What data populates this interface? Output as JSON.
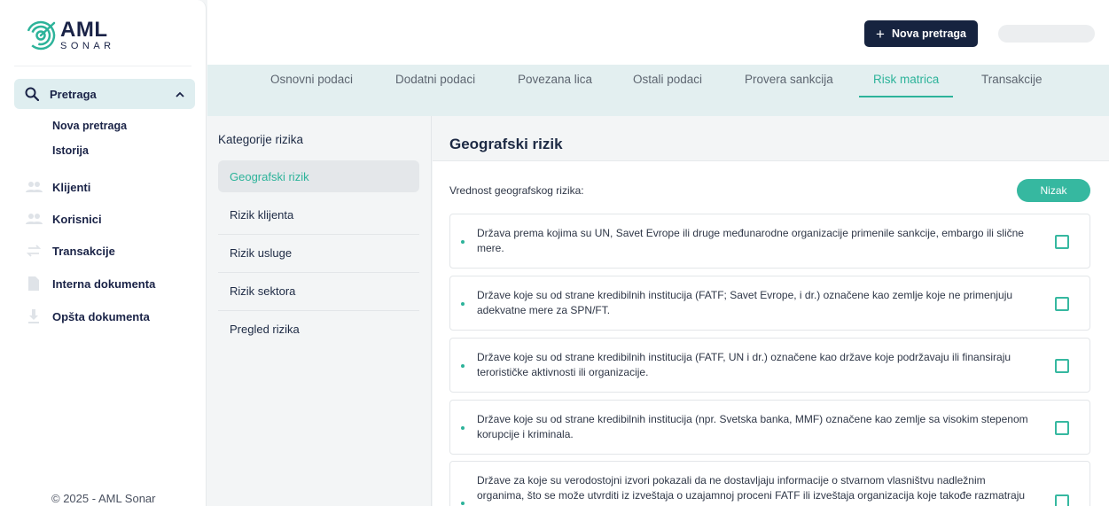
{
  "brand": {
    "name": "AML",
    "sub": "SONAR"
  },
  "sidebar": {
    "search": {
      "label": "Pretraga"
    },
    "sub_items": [
      "Nova pretraga",
      "Istorija"
    ],
    "items": [
      {
        "label": "Klijenti",
        "icon": "clients-icon"
      },
      {
        "label": "Korisnici",
        "icon": "users-icon"
      },
      {
        "label": "Transakcije",
        "icon": "transactions-icon"
      },
      {
        "label": "Interna dokumenta",
        "icon": "document-icon"
      },
      {
        "label": "Opšta dokumenta",
        "icon": "download-icon"
      }
    ],
    "footer": "© 2025 - AML Sonar"
  },
  "topbar": {
    "new_search_label": "Nova pretraga"
  },
  "tabs": [
    "Osnovni podaci",
    "Dodatni podaci",
    "Povezana lica",
    "Ostali podaci",
    "Provera sankcija",
    "Risk matrica",
    "Transakcije"
  ],
  "active_tab": "Risk matrica",
  "categories": {
    "title": "Kategorije rizika",
    "items": [
      "Geografski rizik",
      "Rizik klijenta",
      "Rizik usluge",
      "Rizik sektora",
      "Pregled rizika"
    ]
  },
  "content": {
    "title": "Geografski rizik",
    "value_label": "Vrednost geografskog rizika:",
    "badge": "Nizak",
    "risks": [
      "Država prema kojima su UN, Savet Evrope ili druge međunarodne organizacije primenile sankcije, embargo ili slične mere.",
      "Države koje su od strane kredibilnih institucija (FATF; Savet Evrope, i dr.) označene kao zemlje koje ne primenjuju adekvatne mere za SPN/FT.",
      "Države koje su od strane kredibilnih institucija (FATF, UN i dr.) označene kao države koje podržavaju ili finansiraju terorističke aktivnosti ili organizacije.",
      "Države koje su od strane kredibilnih institucija (npr. Svetska banka, MMF) označene kao zemlje sa visokim stepenom korupcije i kriminala.",
      "Države za koje su verodostojni izvori pokazali da ne dostavljaju informacije o stvarnom vlasništvu nadležnim organima, što se može utvrditi iz izveštaja o uzajamnoj proceni FATF ili izveštaja organizacija koje takođe razmatraju"
    ]
  },
  "colors": {
    "accent": "#2db39a",
    "navy": "#16233f",
    "badge": "#36b8a0"
  }
}
